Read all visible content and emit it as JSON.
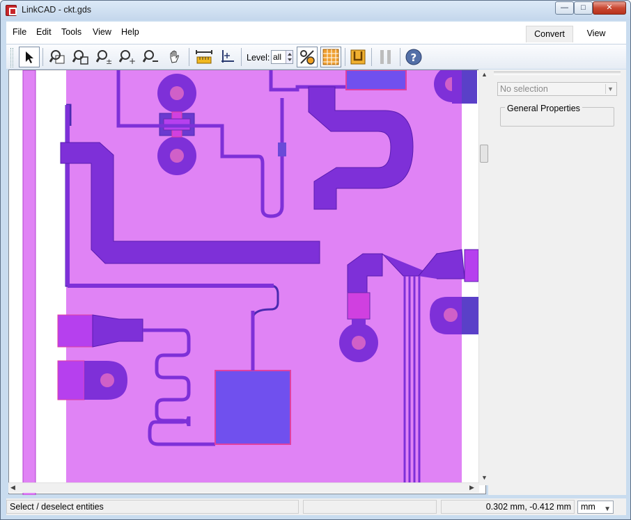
{
  "window": {
    "title": "LinkCAD - ckt.gds"
  },
  "menu": [
    "File",
    "Edit",
    "Tools",
    "View",
    "Help"
  ],
  "tabs": {
    "convert": "Convert",
    "view": "View"
  },
  "toolbar": {
    "level_label": "Level:",
    "level_value": "all",
    "icons": [
      "select-arrow-icon",
      "zoom-window-icon",
      "zoom-fit-icon",
      "zoom-plusminus-icon",
      "zoom-in-icon",
      "zoom-out-icon",
      "pan-hand-icon",
      "measure-icon",
      "origin-icon",
      "layer-toggle-icon",
      "grid-icon",
      "export-icon",
      "pause-icon",
      "help-icon"
    ]
  },
  "panel": {
    "selection": "No selection",
    "group_title": "General Properties"
  },
  "status": {
    "message": "Select / deselect entities",
    "coords": "0.302 mm, -0.412 mm",
    "unit": "mm"
  },
  "colors": {
    "substrate": "#e083f5",
    "trace": "#7e30d8",
    "pad": "#7050ee",
    "via": "#b640ee",
    "outline": "#e040a0"
  }
}
